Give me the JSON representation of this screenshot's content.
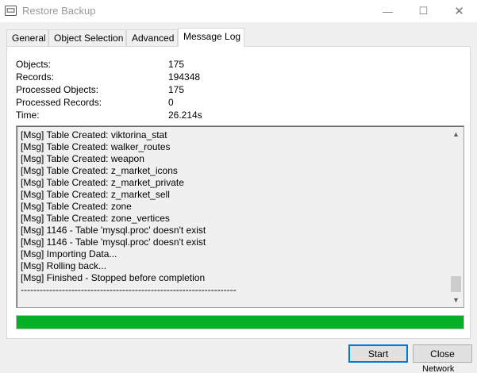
{
  "window": {
    "title": "Restore Backup",
    "minimize_glyph": "—",
    "maximize_glyph": "☐",
    "close_glyph": "✕"
  },
  "tabs": [
    {
      "label": "General",
      "active": false
    },
    {
      "label": "Object Selection",
      "active": false
    },
    {
      "label": "Advanced",
      "active": false
    },
    {
      "label": "Message Log",
      "active": true
    }
  ],
  "stats": [
    {
      "label": "Objects:",
      "value": "175"
    },
    {
      "label": "Records:",
      "value": "194348"
    },
    {
      "label": "Processed Objects:",
      "value": "175"
    },
    {
      "label": "Processed Records:",
      "value": "0"
    },
    {
      "label": "Time:",
      "value": "26.214s"
    }
  ],
  "log_lines": [
    "[Msg] Table Created: viktorina_stat",
    "[Msg] Table Created: walker_routes",
    "[Msg] Table Created: weapon",
    "[Msg] Table Created: z_market_icons",
    "[Msg] Table Created: z_market_private",
    "[Msg] Table Created: z_market_sell",
    "[Msg] Table Created: zone",
    "[Msg] Table Created: zone_vertices",
    "[Msg] 1146 - Table 'mysql.proc' doesn't exist",
    "[Msg] 1146 - Table 'mysql.proc' doesn't exist",
    "[Msg] Importing Data...",
    "[Msg] Rolling back...",
    "[Msg] Finished - Stopped before completion",
    "--------------------------------------------------------------------"
  ],
  "progress": {
    "percent": 100,
    "color": "#06b025"
  },
  "buttons": {
    "start": "Start",
    "close": "Close"
  },
  "background_hint": {
    "text": "Network"
  }
}
